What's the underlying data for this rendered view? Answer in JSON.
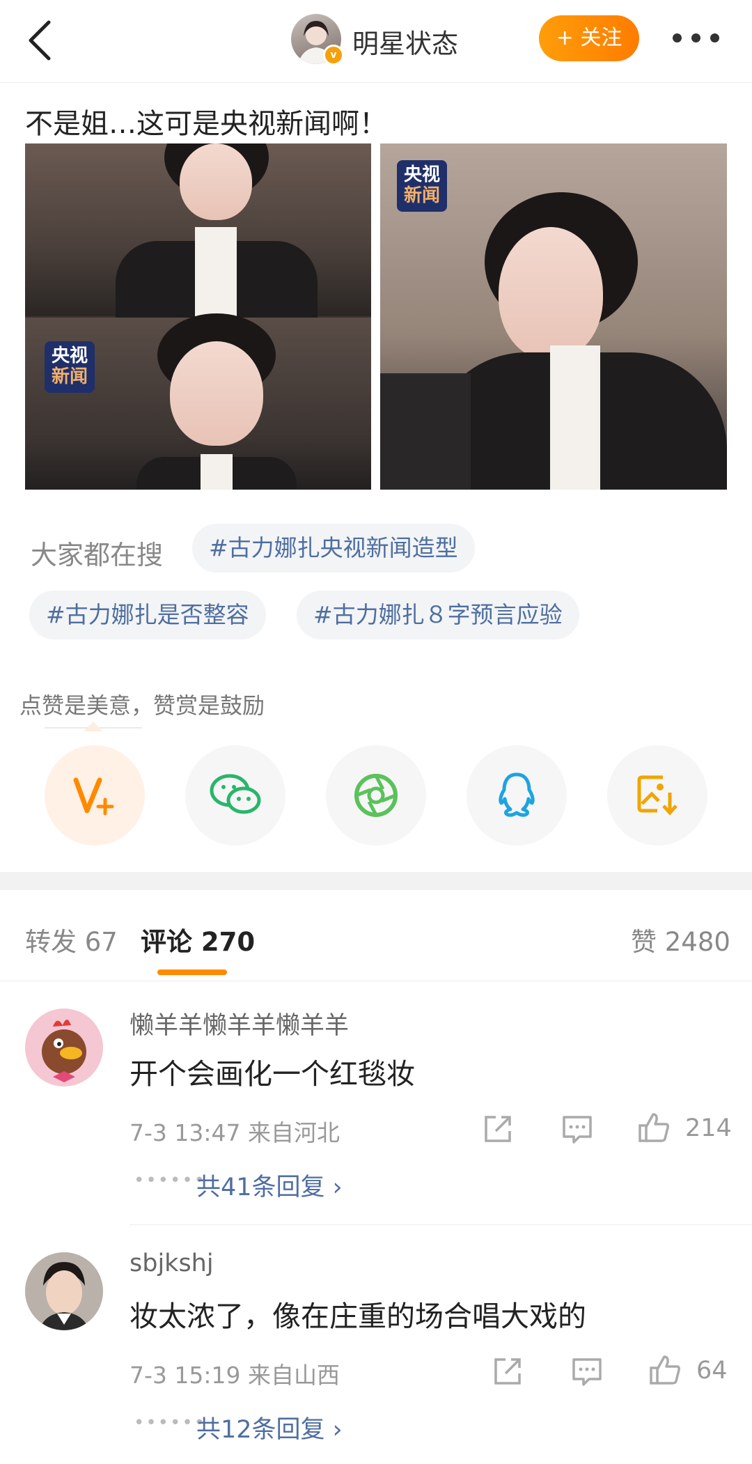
{
  "header": {
    "title": "明星状态",
    "follow_label": "+ 关注"
  },
  "post": {
    "text": "不是姐…这可是央视新闻啊！",
    "watermark_line1": "央视",
    "watermark_line2": "新闻"
  },
  "search": {
    "label": "大家都在搜",
    "tags": [
      "#古力娜扎央视新闻造型",
      "#古力娜扎是否整容",
      "#古力娜扎８字预言应验"
    ]
  },
  "reward": {
    "tip": "点赞是美意，赞赏是鼓励"
  },
  "share_icons": [
    "reward-v-plus-icon",
    "wechat-icon",
    "moments-icon",
    "qq-icon",
    "save-image-icon"
  ],
  "tabs": {
    "repost": "转发 67",
    "comment": "评论 270",
    "likes": "赞 2480"
  },
  "comments": [
    {
      "user": "懒羊羊懒羊羊懒羊羊",
      "text": "开个会画化一个红毯妆",
      "meta": "7-3 13:47  来自河北",
      "likes": "214",
      "replies": "共41条回复 ›"
    },
    {
      "user": "sbjkshj",
      "text": "妆太浓了，像在庄重的场合唱大戏的",
      "meta": "7-3 15:19  来自山西",
      "likes": "64",
      "replies": "共12条回复 ›"
    }
  ],
  "colors": {
    "accent_orange": "#ff8a00",
    "link_blue": "#4f6ea0"
  }
}
